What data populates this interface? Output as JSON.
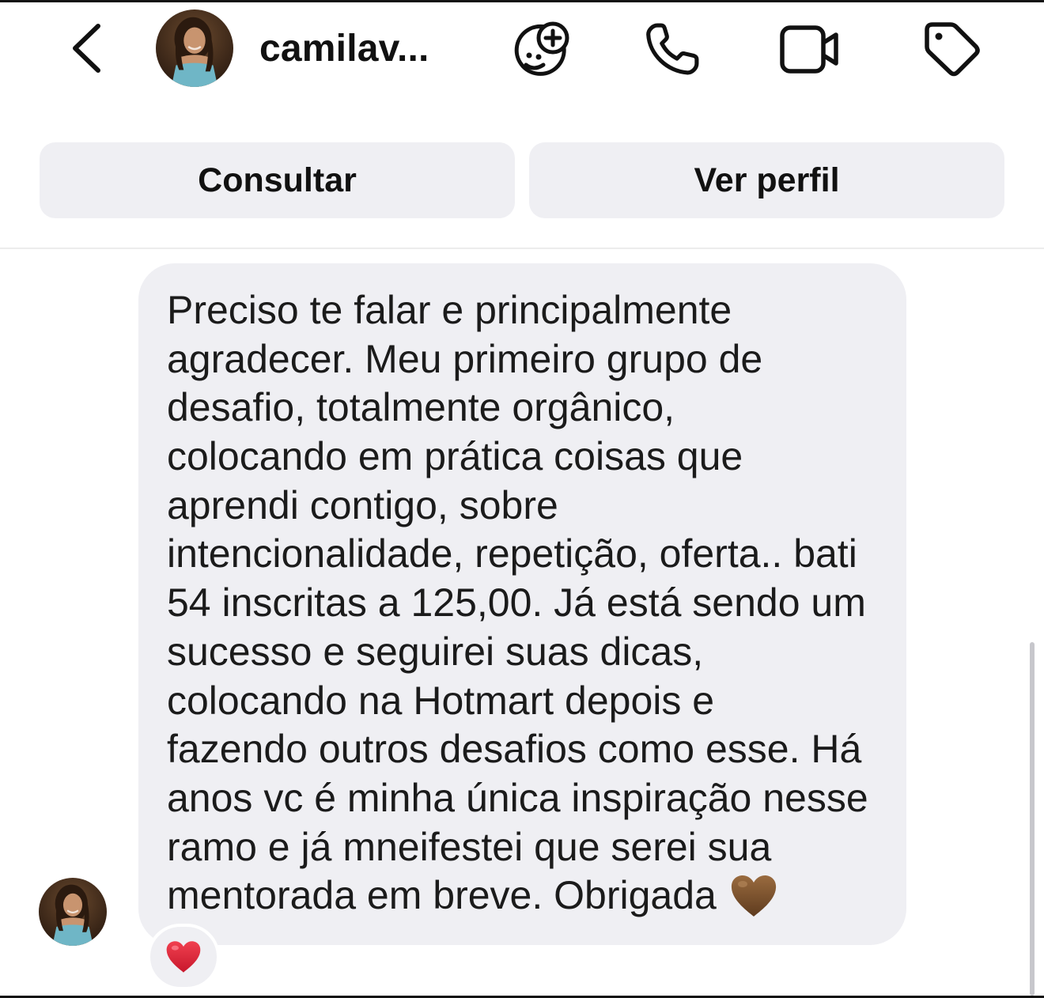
{
  "header": {
    "back_icon": "chevron-left-icon",
    "username": "camilav...",
    "icons": [
      "sticker-add-icon",
      "phone-icon",
      "video-camera-icon",
      "tag-icon"
    ]
  },
  "actions": {
    "consult_label": "Consultar",
    "profile_label": "Ver perfil"
  },
  "message": {
    "lines": [
      "Preciso te falar e principalmente",
      "agradecer. Meu primeiro grupo de",
      "desafio, totalmente orgânico,",
      "colocando em prática coisas que",
      "aprendi contigo, sobre",
      "intencionalidade, repetição, oferta.. bati",
      "54 inscritas a 125,00. Já está sendo um",
      "sucesso e seguirei suas dicas,",
      "colocando na Hotmart depois e",
      "fazendo outros desafios como esse. Há",
      "anos vc é minha única inspiração nesse",
      "ramo e já mneifestei que serei sua",
      "mentorada em breve. Obrigada"
    ],
    "trailing_emoji": "brown-heart-emoji"
  },
  "reaction": {
    "emoji": "red-heart-emoji"
  },
  "colors": {
    "bubble": "#efeff3",
    "button": "#efeff3",
    "text": "#1b1b1b",
    "red_heart": "#e3263c",
    "brown_heart": "#7a5230"
  }
}
